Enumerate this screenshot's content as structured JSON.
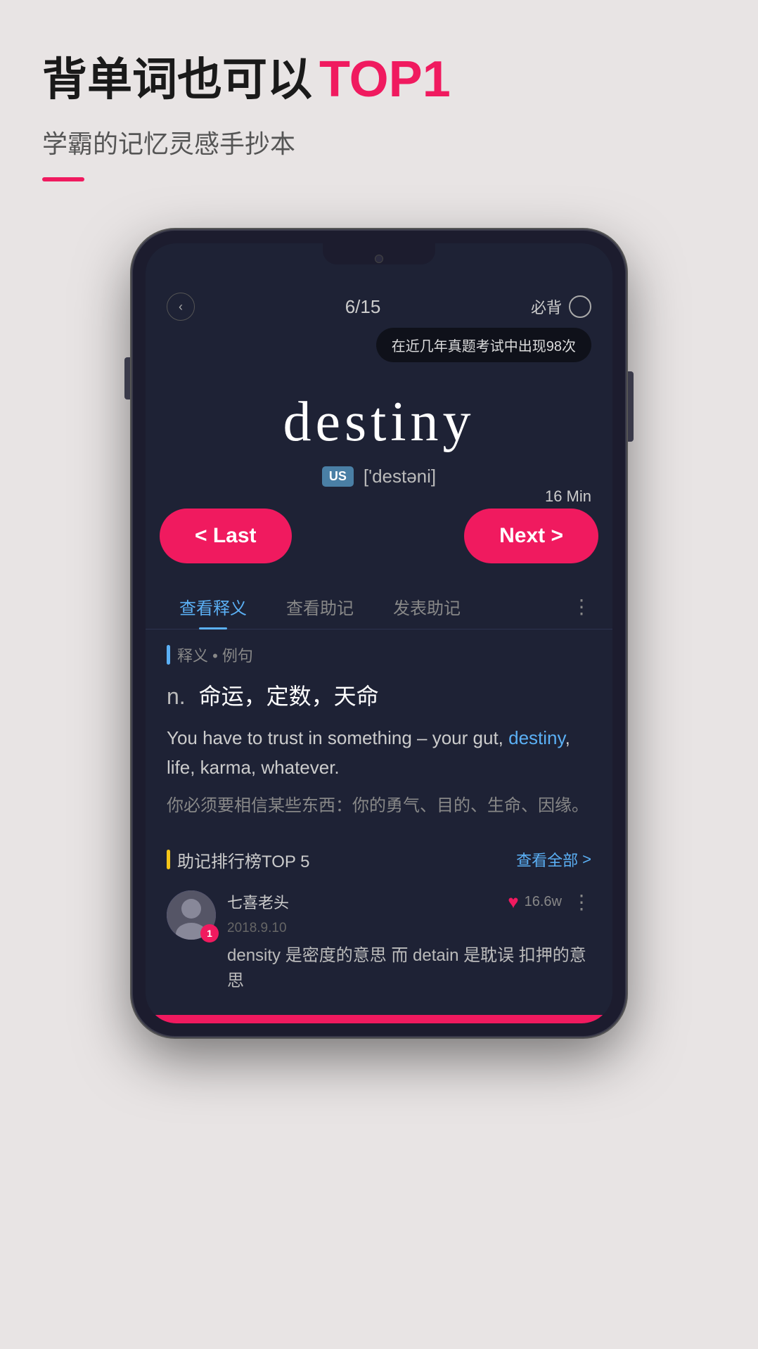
{
  "header": {
    "title_part1": "背单词也可以",
    "title_highlight": "TOP1",
    "subtitle": "学霸的记忆灵感手抄本",
    "divider_color": "#f01a5f"
  },
  "phone": {
    "topbar": {
      "back_label": "‹",
      "progress": "6/15",
      "must_label": "必背"
    },
    "badge": "在近几年真题考试中出现98次",
    "word": {
      "text": "destiny",
      "us_label": "US",
      "phonetic": "['destəni]"
    },
    "timer": "16 Min",
    "nav": {
      "last_label": "< Last",
      "next_label": "Next >"
    },
    "tabs": [
      {
        "label": "查看释义",
        "active": true
      },
      {
        "label": "查看助记",
        "active": false
      },
      {
        "label": "发表助记",
        "active": false
      }
    ],
    "tab_more": "⋮",
    "definition": {
      "section_label": "释义 • 例句",
      "pos": "n.",
      "meaning_cn": "命运，定数，天命",
      "example_en_before": "You have to trust in something –\nyour gut, ",
      "example_en_highlight": "destiny",
      "example_en_after": ", life, karma, whatever.",
      "example_cn": "你必须要相信某些东西：你的勇气、目的、生命、因缘。"
    },
    "mnemonic": {
      "section_label": "助记排行榜TOP 5",
      "view_all": "查看全部",
      "chevron": ">",
      "card": {
        "username": "七喜老头",
        "date": "2018.9.10",
        "rank": "1",
        "like_count": "16.6w",
        "text": "density 是密度的意思 而 detain 是耽误\n扣押的意思"
      }
    }
  }
}
